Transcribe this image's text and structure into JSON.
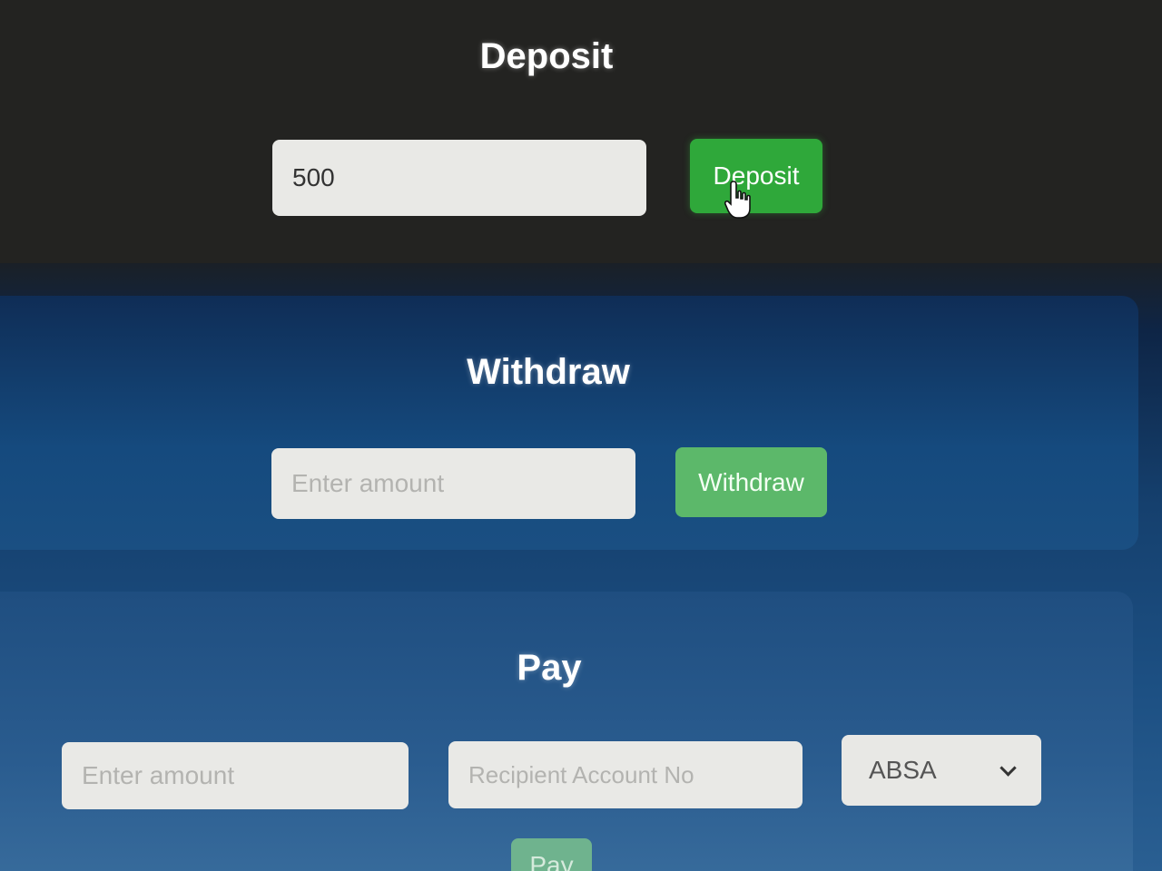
{
  "deposit": {
    "title": "Deposit",
    "amount_value": "500",
    "button_label": "Deposit"
  },
  "withdraw": {
    "title": "Withdraw",
    "amount_placeholder": "Enter amount",
    "button_label": "Withdraw"
  },
  "pay": {
    "title": "Pay",
    "amount_placeholder": "Enter amount",
    "recipient_placeholder": "Recipient Account No",
    "bank_selected": "ABSA",
    "button_label": "Pay"
  },
  "colors": {
    "deposit_button": "#2fa83a",
    "withdraw_button": "#5cb86a",
    "pay_button": "#6fb38e"
  },
  "icons": {
    "cursor": "hand-pointer-cursor-icon",
    "select_arrow": "chevron-down-icon"
  }
}
